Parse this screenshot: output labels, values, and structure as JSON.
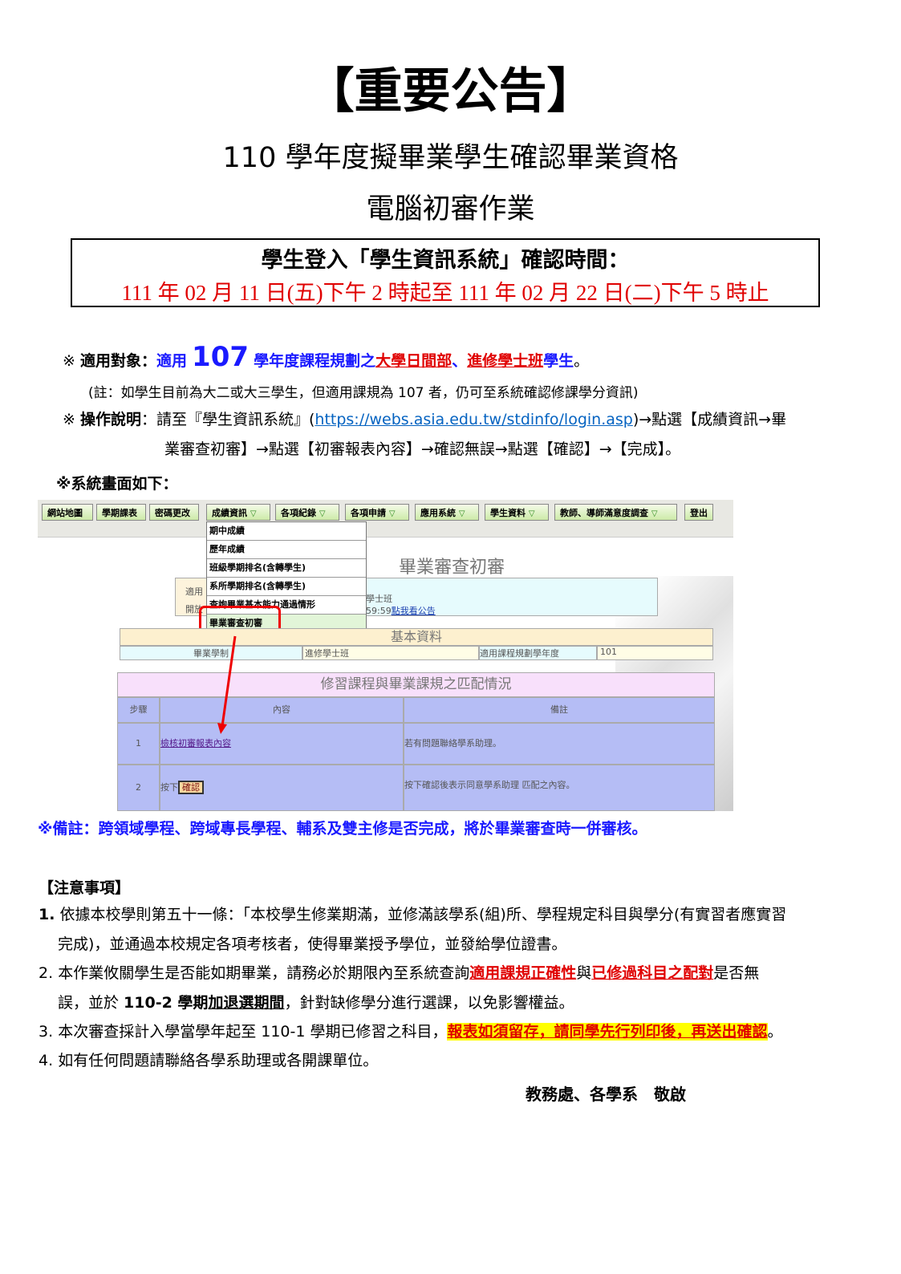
{
  "title": "【重要公告】",
  "subtitle1": "110 學年度擬畢業學生確認畢業資格",
  "subtitle2": "電腦初審作業",
  "period_box": {
    "line1": "學生登入「學生資訊系統」確認時間：",
    "line2": "111 年 02 月 11 日(五)下午 2 時起至 111 年 02 月 22 日(二)下午 5 時止"
  },
  "scope": {
    "mark": "※",
    "label": "適用對象：",
    "text1": "適用",
    "year": "107",
    "text2": "學年度課程規劃之",
    "dept1": "大學日間部",
    "sep": "、",
    "dept2": "進修學士班",
    "text3": "學生",
    "end": "。"
  },
  "scope_note": "(註：如學生目前為大二或大三學生，但適用課規為 107 者，仍可至系統確認修課學分資訊)",
  "instructions": {
    "mark": "※",
    "label": "操作說明",
    "text1": "：請至『學生資訊系統』(",
    "url": "https://webs.asia.edu.tw/stdinfo/login.asp",
    "text2": ")→點選【成績資訊→畢",
    "line2": "業審查初審】→點選【初審報表內容】→確認無誤→點選【確認】→【完成】。"
  },
  "screen_label": "※系統畫面如下：",
  "screenshot": {
    "nav": [
      "網站地圖",
      "學期課表",
      "密碼更改",
      "成績資訊",
      "各項紀錄",
      "各項申請",
      "應用系統",
      "學生資料",
      "教師、導師滿意度調查",
      "登出"
    ],
    "dropdown": [
      "期中成績",
      "歷年成績",
      "班級學期排名(含轉學生)",
      "系所學期排名(含轉學生)",
      "查詢畢業基本能力通過情形",
      "畢業審查初審"
    ],
    "page_title": "畢業審查初審",
    "info_labels": [
      "適用",
      "開放"
    ],
    "info_values": [
      "學士班",
      "59:59"
    ],
    "info_link": "點我看公告",
    "basic_title": "基本資料",
    "basic_row": [
      "畢業學制",
      "進修學士班",
      "適用課程規劃學年度",
      "101"
    ],
    "match_title": "修習課程與畢業課規之匹配情況",
    "headers": [
      "步驟",
      "內容",
      "備註"
    ],
    "rows": [
      {
        "step": "1",
        "content": "檢核初審報表內容",
        "remark": "若有問題聯絡學系助理。"
      },
      {
        "step": "2",
        "content_prefix": "按下",
        "button": "確認",
        "remark": "按下確認後表示同意學系助理 匹配之內容。"
      }
    ]
  },
  "remark": "※備註：跨領域學程、跨域專長學程、輔系及雙主修是否完成，將於畢業審查時一併審核。",
  "notes_title": "【注意事項】",
  "notes": {
    "n1_num": "1.",
    "n1": "依據本校學則第五十一條：「本校學生修業期滿，並修滿該學系(組)所、學程規定科目與學分(有實習者應實習",
    "n1b": "完成)，並通過本校規定各項考核者，使得畢業授予學位，並發給學位證書。",
    "n2_num": "2.",
    "n2a": "本作業攸關學生是否能如期畢業，請務必於期限內至系統查詢",
    "n2_hl1": "適用課規正確性",
    "n2b": "與",
    "n2_hl2": "已修過科目之配對",
    "n2c": "是否無",
    "n2d": "誤，並於 ",
    "n2_term": "110-2 學期",
    "n2_period": "加退選期間",
    "n2e": "，針對缺修學分進行選課，以免影響權益。",
    "n3_num": "3.",
    "n3a": "本次審查採計入學當學年起至 110-1 學期已修習之科目，",
    "n3_hl": "報表如須留存，請同學先行列印後，再送出確認",
    "n3b": "。",
    "n4_num": "4.",
    "n4": "如有任何問題請聯絡各學系助理或各開課單位。"
  },
  "signature": "教務處、各學系　敬啟",
  "colors": {
    "red": "#e00000",
    "blue": "#1a1aff",
    "link": "#0563c1",
    "highlight": "#ffff00"
  }
}
